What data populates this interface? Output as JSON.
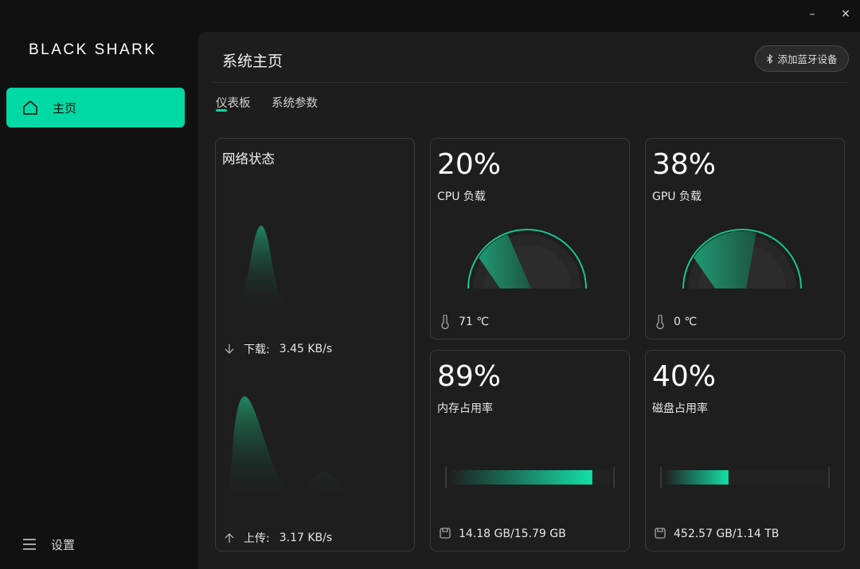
{
  "window": {
    "minimize_glyph": "–",
    "close_glyph": "✕"
  },
  "brand": "BLACK SHARK",
  "sidebar": {
    "home_label": "主页",
    "home_icon": "home-icon",
    "settings_label": "设置",
    "settings_icon": "menu-icon"
  },
  "header": {
    "title": "系统主页",
    "bt_button_label": "添加蓝牙设备",
    "bt_icon": "bluetooth-icon"
  },
  "tabs": [
    {
      "label": "仪表板",
      "active": true
    },
    {
      "label": "系统参数",
      "active": false
    }
  ],
  "network": {
    "title": "网络状态",
    "download_label": "下载:",
    "download_value": "3.45 KB/s",
    "upload_label": "上传:",
    "upload_value": "3.17 KB/s"
  },
  "cpu": {
    "value": "20%",
    "label": "CPU 负载",
    "percent": 20,
    "temp": "71 ℃"
  },
  "gpu": {
    "value": "38%",
    "label": "GPU 负载",
    "percent": 38,
    "temp": "0 ℃"
  },
  "memory": {
    "value": "89%",
    "label": "内存占用率",
    "percent": 89,
    "usage": "14.18 GB/15.79 GB"
  },
  "disk": {
    "value": "40%",
    "label": "磁盘占用率",
    "percent": 40,
    "usage": "452.57 GB/1.14 TB"
  },
  "colors": {
    "accent": "#00d9a3",
    "card_bg": "#1e1e1e",
    "panel_bg": "#1d1d1d",
    "sidebar_bg": "#111111"
  }
}
